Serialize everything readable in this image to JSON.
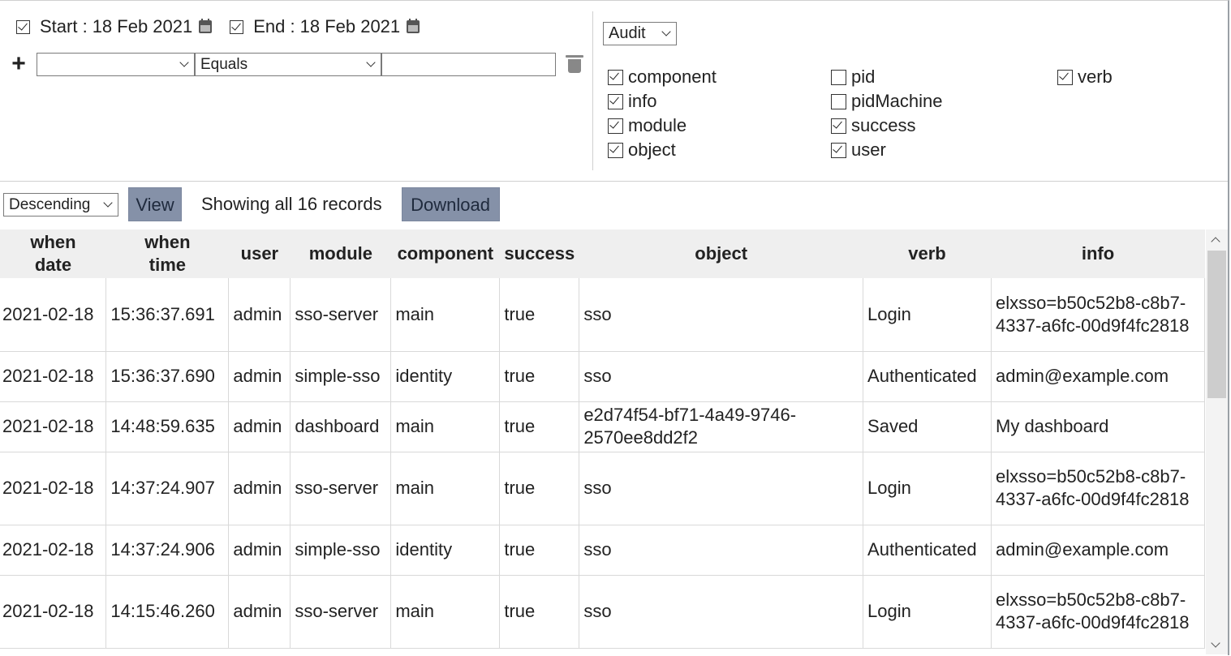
{
  "dates": {
    "start": {
      "label": "Start :",
      "value": "18 Feb 2021",
      "checked": true
    },
    "end": {
      "label": "End :",
      "value": "18 Feb 2021",
      "checked": true
    }
  },
  "filter": {
    "field_value": "",
    "operator_value": "Equals",
    "text_value": ""
  },
  "log_type": "Audit",
  "fields": [
    {
      "label": "component",
      "checked": true
    },
    {
      "label": "info",
      "checked": true
    },
    {
      "label": "module",
      "checked": true
    },
    {
      "label": "object",
      "checked": true
    },
    {
      "label": "pid",
      "checked": false
    },
    {
      "label": "pidMachine",
      "checked": false
    },
    {
      "label": "success",
      "checked": true
    },
    {
      "label": "user",
      "checked": true
    },
    {
      "label": "verb",
      "checked": true
    }
  ],
  "toolbar": {
    "order": "Descending",
    "view_label": "View",
    "records_text": "Showing all 16 records",
    "download_label": "Download"
  },
  "table": {
    "headers": [
      {
        "line1": "when",
        "line2": "date"
      },
      {
        "line1": "when",
        "line2": "time"
      },
      {
        "line1": "user",
        "line2": ""
      },
      {
        "line1": "module",
        "line2": ""
      },
      {
        "line1": "component",
        "line2": ""
      },
      {
        "line1": "success",
        "line2": ""
      },
      {
        "line1": "object",
        "line2": ""
      },
      {
        "line1": "verb",
        "line2": ""
      },
      {
        "line1": "info",
        "line2": ""
      }
    ],
    "rows": [
      [
        "2021-02-18",
        "15:36:37.691",
        "admin",
        "sso-server",
        "main",
        "true",
        "sso",
        "Login",
        "elxsso=b50c52b8-c8b7-4337-a6fc-00d9f4fc2818"
      ],
      [
        "2021-02-18",
        "15:36:37.690",
        "admin",
        "simple-sso",
        "identity",
        "true",
        "sso",
        "Authenticated",
        "admin@example.com"
      ],
      [
        "2021-02-18",
        "14:48:59.635",
        "admin",
        "dashboard",
        "main",
        "true",
        "e2d74f54-bf71-4a49-9746-2570ee8dd2f2",
        "Saved",
        "My dashboard"
      ],
      [
        "2021-02-18",
        "14:37:24.907",
        "admin",
        "sso-server",
        "main",
        "true",
        "sso",
        "Login",
        "elxsso=b50c52b8-c8b7-4337-a6fc-00d9f4fc2818"
      ],
      [
        "2021-02-18",
        "14:37:24.906",
        "admin",
        "simple-sso",
        "identity",
        "true",
        "sso",
        "Authenticated",
        "admin@example.com"
      ],
      [
        "2021-02-18",
        "14:15:46.260",
        "admin",
        "sso-server",
        "main",
        "true",
        "sso",
        "Login",
        "elxsso=b50c52b8-c8b7-4337-a6fc-00d9f4fc2818"
      ]
    ]
  }
}
